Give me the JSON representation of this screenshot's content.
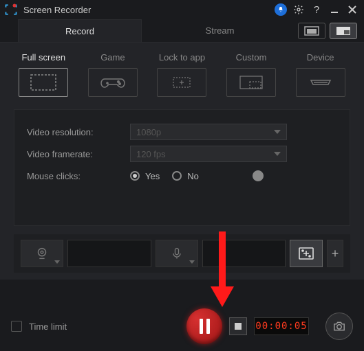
{
  "app": {
    "title": "Screen Recorder"
  },
  "tabs": {
    "record": "Record",
    "stream": "Stream"
  },
  "sources": {
    "full_screen": "Full screen",
    "game": "Game",
    "lock_to_app": "Lock to app",
    "custom": "Custom",
    "device": "Device"
  },
  "settings": {
    "resolution_label": "Video resolution:",
    "resolution_value": "1080p",
    "framerate_label": "Video framerate:",
    "framerate_value": "120 fps",
    "mouse_label": "Mouse clicks:",
    "yes": "Yes",
    "no": "No"
  },
  "bottom": {
    "time_limit": "Time limit",
    "timer": "00:00:05"
  },
  "icons": {
    "plus": "+"
  }
}
